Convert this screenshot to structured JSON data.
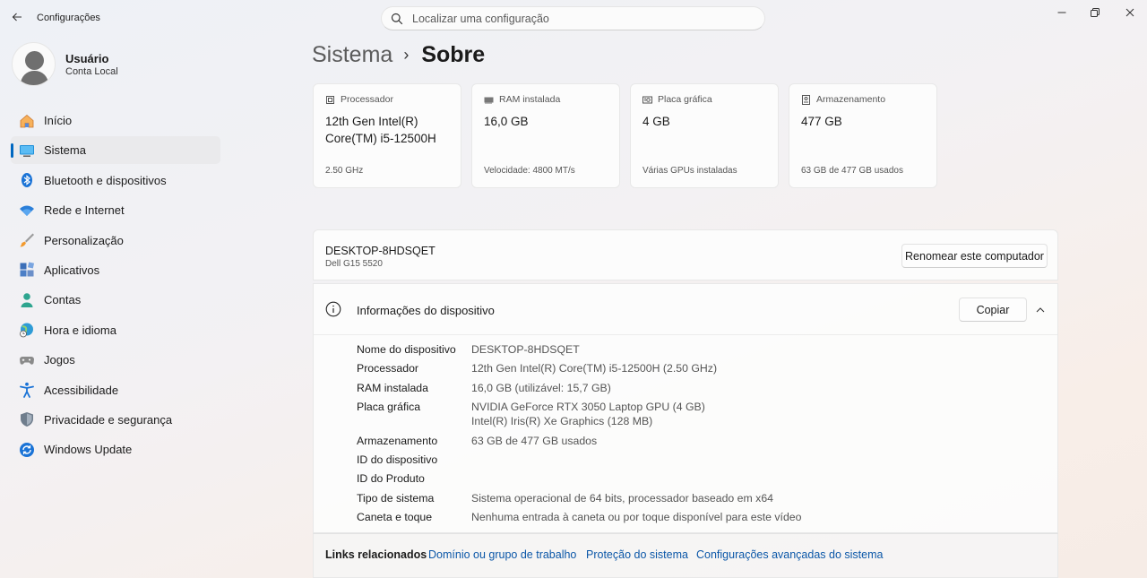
{
  "window": {
    "title": "Configurações",
    "controls": [
      "minimize",
      "maximize",
      "close"
    ]
  },
  "search": {
    "placeholder": "Localizar uma configuração"
  },
  "user": {
    "name": "Usuário",
    "account_type": "Conta Local"
  },
  "sidebar": {
    "items": [
      {
        "label": "Início",
        "icon": "home-icon"
      },
      {
        "label": "Sistema",
        "icon": "system-icon",
        "active": true
      },
      {
        "label": "Bluetooth e dispositivos",
        "icon": "bluetooth-icon"
      },
      {
        "label": "Rede e Internet",
        "icon": "wifi-icon"
      },
      {
        "label": "Personalização",
        "icon": "brush-icon"
      },
      {
        "label": "Aplicativos",
        "icon": "apps-icon"
      },
      {
        "label": "Contas",
        "icon": "person-icon"
      },
      {
        "label": "Hora e idioma",
        "icon": "globe-clock-icon"
      },
      {
        "label": "Jogos",
        "icon": "gamepad-icon"
      },
      {
        "label": "Acessibilidade",
        "icon": "accessibility-icon"
      },
      {
        "label": "Privacidade e segurança",
        "icon": "shield-icon"
      },
      {
        "label": "Windows Update",
        "icon": "update-icon"
      }
    ]
  },
  "breadcrumb": {
    "parent": "Sistema",
    "separator": "›",
    "current": "Sobre"
  },
  "specs": [
    {
      "label": "Processador",
      "icon": "cpu-icon",
      "value": "12th Gen Intel(R) Core(TM) i5-12500H",
      "sub": "2.50 GHz"
    },
    {
      "label": "RAM instalada",
      "icon": "ram-icon",
      "value": "16,0 GB",
      "sub": "Velocidade: 4800 MT/s"
    },
    {
      "label": "Placa gráfica",
      "icon": "gpu-icon",
      "value": "4 GB",
      "sub": "Várias GPUs instaladas"
    },
    {
      "label": "Armazenamento",
      "icon": "storage-icon",
      "value": "477 GB",
      "sub": "63 GB de 477 GB usados"
    }
  ],
  "computer": {
    "name": "DESKTOP-8HDSQET",
    "model": "Dell G15 5520",
    "rename_label": "Renomear este computador"
  },
  "device_info": {
    "title": "Informações do dispositivo",
    "copy_label": "Copiar",
    "rows": [
      {
        "key": "Nome do dispositivo",
        "value": "DESKTOP-8HDSQET"
      },
      {
        "key": "Processador",
        "value": "12th Gen Intel(R) Core(TM) i5-12500H (2.50 GHz)"
      },
      {
        "key": "RAM instalada",
        "value": "16,0 GB (utilizável: 15,7 GB)"
      },
      {
        "key": "Placa gráfica",
        "value": "NVIDIA GeForce RTX 3050 Laptop GPU (4 GB)\nIntel(R) Iris(R) Xe Graphics (128 MB)"
      },
      {
        "key": "Armazenamento",
        "value": "63 GB de 477 GB usados"
      },
      {
        "key": "ID do dispositivo",
        "value": ""
      },
      {
        "key": "ID do Produto",
        "value": ""
      },
      {
        "key": "Tipo de sistema",
        "value": "Sistema operacional de 64 bits, processador baseado em x64"
      },
      {
        "key": "Caneta e toque",
        "value": "Nenhuma entrada à caneta ou por toque disponível para este vídeo"
      }
    ]
  },
  "related_links": {
    "title": "Links relacionados",
    "links": [
      "Domínio ou grupo de trabalho",
      "Proteção do sistema",
      "Configurações avançadas do sistema"
    ]
  },
  "colors": {
    "accent": "#0067c0",
    "link": "#0b57a8"
  }
}
